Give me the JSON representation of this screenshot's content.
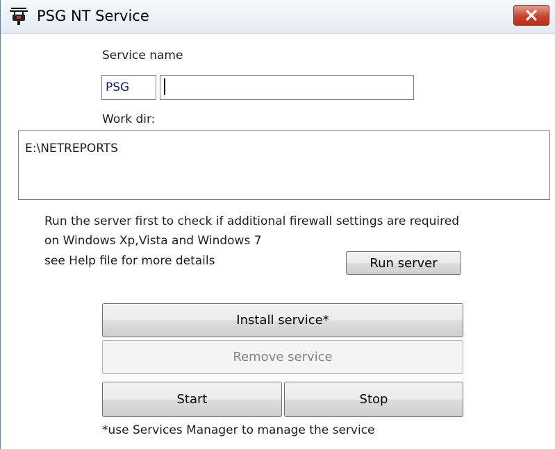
{
  "window": {
    "title": "PSG NT Service",
    "app_icon": "service-plug-icon",
    "close_icon": "close-icon"
  },
  "service_name": {
    "label": "Service name",
    "prefix": "PSG",
    "value": ""
  },
  "work_dir": {
    "label": "Work dir:",
    "value": "E:\\NETREPORTS"
  },
  "firewall_note": {
    "line1": "Run the server first to check if additional firewall settings are required",
    "line2": "on Windows Xp,Vista and Windows 7",
    "line3": "see Help file for more details"
  },
  "buttons": {
    "run_server": "Run server",
    "install_service": "Install service*",
    "remove_service": "Remove service",
    "start": "Start",
    "stop": "Stop"
  },
  "footnote": "*use Services Manager to manage the service",
  "colors": {
    "close_button": "#c8442e",
    "prefix_text": "#0a246a",
    "disabled_text": "#838383"
  }
}
